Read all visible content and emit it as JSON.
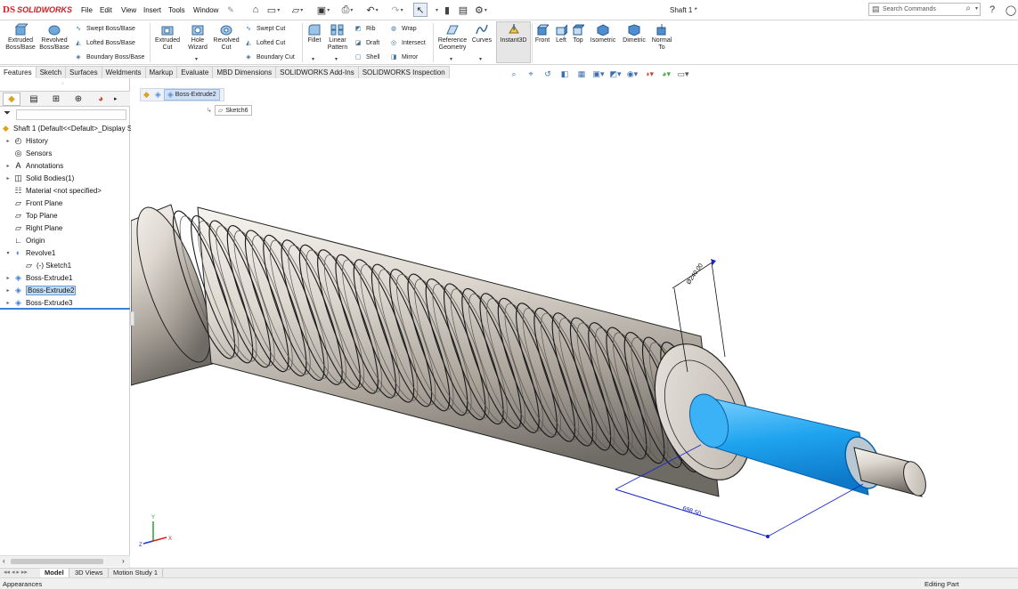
{
  "app": {
    "logo_ds": "DS",
    "logo_name": "SOLIDWORKS",
    "doc_title": "Shaft 1 *"
  },
  "menu": [
    "File",
    "Edit",
    "View",
    "Insert",
    "Tools",
    "Window"
  ],
  "search": {
    "placeholder": "Search Commands"
  },
  "commands": {
    "extruded_boss": "Extruded Boss/Base",
    "revolved_boss": "Revolved Boss/Base",
    "swept_boss": "Swept Boss/Base",
    "lofted_boss": "Lofted Boss/Base",
    "boundary_boss": "Boundary Boss/Base",
    "extruded_cut": "Extruded Cut",
    "hole_wizard": "Hole Wizard",
    "revolved_cut": "Revolved Cut",
    "swept_cut": "Swept Cut",
    "lofted_cut": "Lofted Cut",
    "boundary_cut": "Boundary Cut",
    "fillet": "Fillet",
    "linear_pattern": "Linear Pattern",
    "rib": "Rib",
    "draft": "Draft",
    "shell": "Shell",
    "wrap": "Wrap",
    "intersect": "Intersect",
    "mirror": "Mirror",
    "reference_geometry": "Reference Geometry",
    "curves": "Curves",
    "instant3d": "Instant3D",
    "front": "Front",
    "left": "Left",
    "top": "Top",
    "isometric": "Isometric",
    "dimetric": "Dimetric",
    "normal_to": "Normal To"
  },
  "tabs": [
    "Features",
    "Sketch",
    "Surfaces",
    "Weldments",
    "Markup",
    "Evaluate",
    "MBD Dimensions",
    "SOLIDWORKS Add-Ins",
    "SOLIDWORKS Inspection"
  ],
  "tree": {
    "root": "Shaft 1  (Default<<Default>_Display St",
    "items": [
      {
        "label": "History",
        "icon": "history-icon",
        "expand": true
      },
      {
        "label": "Sensors",
        "icon": "sensors-icon",
        "expand": false
      },
      {
        "label": "Annotations",
        "icon": "annotations-icon",
        "expand": true
      },
      {
        "label": "Solid Bodies(1)",
        "icon": "solid-bodies-icon",
        "expand": true
      },
      {
        "label": "Material <not specified>",
        "icon": "material-icon",
        "expand": false
      },
      {
        "label": "Front Plane",
        "icon": "plane-icon",
        "expand": false
      },
      {
        "label": "Top Plane",
        "icon": "plane-icon",
        "expand": false
      },
      {
        "label": "Right Plane",
        "icon": "plane-icon",
        "expand": false
      },
      {
        "label": "Origin",
        "icon": "origin-icon",
        "expand": false
      },
      {
        "label": "Revolve1",
        "icon": "revolve-icon",
        "expand": true
      },
      {
        "label": "(-) Sketch1",
        "icon": "sketch-icon",
        "expand": false
      },
      {
        "label": "Boss-Extrude1",
        "icon": "extrude-icon",
        "expand": true
      },
      {
        "label": "Boss-Extrude2",
        "icon": "extrude-icon",
        "expand": true
      },
      {
        "label": "Boss-Extrude3",
        "icon": "extrude-icon",
        "expand": true
      }
    ]
  },
  "breadcrumb": {
    "feature": "Boss-Extrude2",
    "sketch": "Sketch6"
  },
  "dimensions": {
    "diameter": "Ø240.00",
    "length": "698.50"
  },
  "triad": {
    "x": "X",
    "y": "Y",
    "z": "Z"
  },
  "bottom_tabs": [
    "Model",
    "3D Views",
    "Motion Study 1"
  ],
  "status": {
    "left": "Appearances",
    "right": "Editing Part"
  },
  "colors": {
    "accent": "#1f9fe8",
    "brand": "#d71920",
    "selection": "#c6dcf6"
  }
}
